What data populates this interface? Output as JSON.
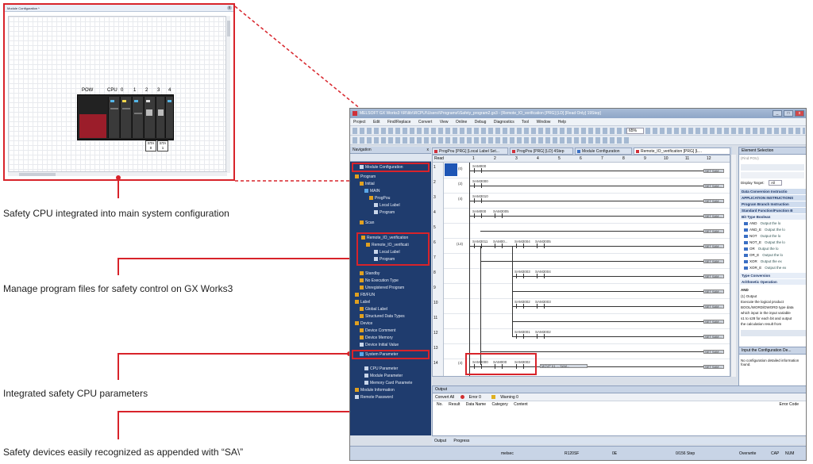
{
  "module_config_window": {
    "title": "Module Configuration *",
    "close": "x",
    "rack_labels": [
      "POW",
      "CPU",
      "0",
      "1",
      "2",
      "3",
      "4"
    ],
    "sta_boxes": [
      {
        "label": "STA",
        "value": "0"
      },
      {
        "label": "STA",
        "value": "1"
      }
    ]
  },
  "captions": {
    "c1": "Safety CPU integrated into main system configuration",
    "c2": "Manage program files for safety control on GX Works3",
    "c3": "Integrated safety CPU parameters",
    "c4": "Safety devices easily recognized as appended with “SA\\”"
  },
  "app": {
    "title": "MELSOFT GX Works3 \\\\R\\\\lib\\\\RCPU\\\\Users\\\\Programs\\\\Safety_program2.gx3 - [Remote_IO_verification [PRG] [LD] [Read Only] 19Step]",
    "window_controls": [
      "_",
      "□",
      "x"
    ],
    "menu": [
      "Project",
      "Edit",
      "Find/Replace",
      "Convert",
      "View",
      "Online",
      "Debug",
      "Diagnostics",
      "Tool",
      "Window",
      "Help"
    ],
    "zoom": "65%"
  },
  "navigation": {
    "title": "Navigation",
    "items": [
      {
        "label": "Module Configuration",
        "kind": "doc"
      },
      {
        "label": "Program",
        "kind": "folder"
      },
      {
        "label": "Initial",
        "kind": "folder"
      },
      {
        "label": "MAIN",
        "kind": "blue"
      },
      {
        "label": "ProgPou",
        "kind": "folder"
      },
      {
        "label": "Local Label",
        "kind": "doc"
      },
      {
        "label": "Program",
        "kind": "doc"
      },
      {
        "label": "Scan",
        "kind": "folder"
      },
      {
        "label": "Remote_IO_verification",
        "kind": "folder"
      },
      {
        "label": "Remote_IO_verificati",
        "kind": "folder"
      },
      {
        "label": "Local Label",
        "kind": "doc"
      },
      {
        "label": "Program",
        "kind": "doc"
      },
      {
        "label": "Standby",
        "kind": "folder"
      },
      {
        "label": "No Execution Type",
        "kind": "folder"
      },
      {
        "label": "Unregistered Program",
        "kind": "folder"
      },
      {
        "label": "FB/FUN",
        "kind": "folder"
      },
      {
        "label": "Label",
        "kind": "folder"
      },
      {
        "label": "Global Label",
        "kind": "folder"
      },
      {
        "label": "Structured Data Types",
        "kind": "folder"
      },
      {
        "label": "Device",
        "kind": "folder"
      },
      {
        "label": "Device Comment",
        "kind": "folder"
      },
      {
        "label": "Device Memory",
        "kind": "folder"
      },
      {
        "label": "Device Initial Value",
        "kind": "doc"
      },
      {
        "label": "System Parameter",
        "kind": "blue"
      },
      {
        "label": "CPU Parameter",
        "kind": "doc"
      },
      {
        "label": "Module Parameter",
        "kind": "doc"
      },
      {
        "label": "Memory Card Paramete",
        "kind": "doc"
      },
      {
        "label": "Module Information",
        "kind": "folder"
      },
      {
        "label": "Remote Password",
        "kind": "doc"
      }
    ]
  },
  "tabs": [
    {
      "label": "ProgPou [PRG] [Local Label Set..."
    },
    {
      "label": "ProgPou [PRG] [LD] 4Step"
    },
    {
      "label": "Module Configuration"
    },
    {
      "label": "Remote_IO_verification [PRG] [L..."
    }
  ],
  "ladder": {
    "mode": "Read",
    "col_headers": [
      "1",
      "2",
      "3",
      "4",
      "5",
      "6",
      "7",
      "8",
      "9",
      "10",
      "11",
      "12"
    ],
    "rows": [
      "1",
      "2",
      "3",
      "4",
      "5",
      "6",
      "7",
      "8",
      "9",
      "10",
      "11",
      "12",
      "13",
      "14"
    ],
    "steps": [
      {
        "row": 1,
        "text": "(0)"
      },
      {
        "row": 2,
        "text": "(2)"
      },
      {
        "row": 3,
        "text": "(4)"
      },
      {
        "row": 5,
        "text": "(13)"
      },
      {
        "row": 14,
        "text": "(4)"
      }
    ],
    "contacts": [
      {
        "label": "SAM000"
      },
      {
        "label": "SAM3000"
      },
      {
        "label": "SAM3010"
      },
      {
        "label": "SAM000"
      },
      {
        "label": "SAM3005"
      },
      {
        "label": "SAM3011"
      },
      {
        "label": "SAM00..."
      },
      {
        "label": "SAM3004"
      },
      {
        "label": "SAM3005"
      },
      {
        "label": "SAM3003"
      },
      {
        "label": "SAM3004"
      },
      {
        "label": "SAM3002"
      },
      {
        "label": "SAM3003"
      },
      {
        "label": "SAM3001"
      },
      {
        "label": "SAM3002"
      },
      {
        "label": "SAM3000"
      },
      {
        "label": "SAM000"
      },
      {
        "label": "SAM3002"
      }
    ],
    "coil_text": "SET SAM...",
    "instr_text": "MOVP K1 ... SAM..."
  },
  "element_selection": {
    "title": "Element Selection",
    "find_placeholder": "(Find POU)",
    "display_target_label": "Display Target:",
    "display_target_value": "All",
    "bands": [
      "Data Conversion Instructio",
      "APPLICATION INSTRUCTIONS",
      "Program Branch Instruction",
      "Standard Function/Function B",
      "Bit Type Boolean"
    ],
    "items": [
      {
        "name": "AND",
        "desc": "Output the lo"
      },
      {
        "name": "AND_E",
        "desc": "Output the lo"
      },
      {
        "name": "NOT",
        "desc": "Output the lo"
      },
      {
        "name": "NOT_E",
        "desc": "Output the lo"
      },
      {
        "name": "OR",
        "desc": "Output the lo"
      },
      {
        "name": "OR_E",
        "desc": "Output the lo"
      },
      {
        "name": "XOR",
        "desc": "Output the ex"
      },
      {
        "name": "XOR_E",
        "desc": "Output the ex"
      }
    ],
    "bands2": [
      "Type Conversion",
      "Arithmetic Operation"
    ],
    "desc_title": "AND",
    "desc_lines": [
      "(1) Output",
      "Execute the logical product",
      "BOOL/WORD/DWORD type data",
      "which input in the input variable",
      "s1 to s28 for each bit and output",
      "the calculation result from"
    ]
  },
  "config_details": {
    "title": "Input the Configuration De...",
    "text": "No configuration detailed information found."
  },
  "output": {
    "title": "Output",
    "convert_all": "Convert All",
    "error": "Error 0",
    "warning": "Warning 0",
    "columns": [
      "No.",
      "Result",
      "Data Name",
      "Category",
      "Content"
    ],
    "error_code": "Error Code"
  },
  "bottom_tabs": [
    "Output",
    "Progress"
  ],
  "statusbar": {
    "items": [
      "melsec",
      "R120SF",
      "0E",
      "0/156 Step",
      "Overwrite",
      "CAP",
      "NUM"
    ]
  }
}
